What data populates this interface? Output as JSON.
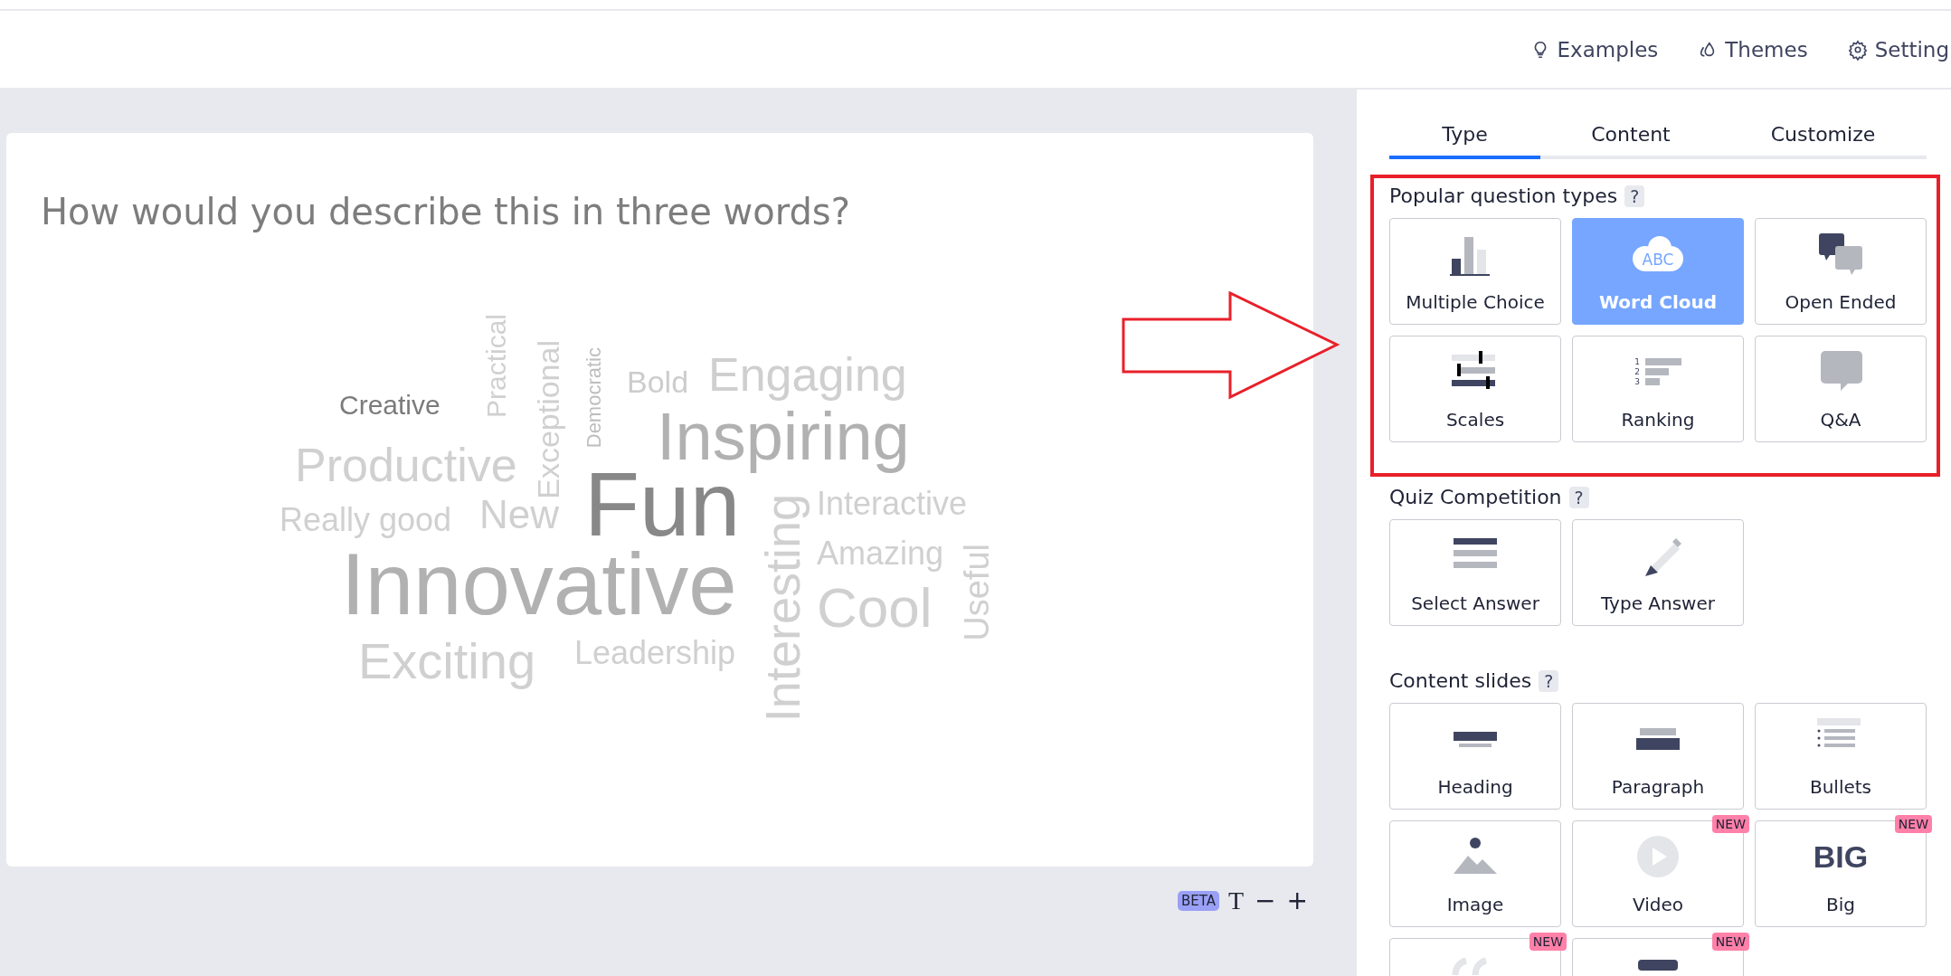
{
  "header": {
    "links": [
      {
        "kind": "bulb",
        "label": "Examples"
      },
      {
        "kind": "drop",
        "label": "Themes"
      },
      {
        "kind": "gear",
        "label": "Setting"
      }
    ]
  },
  "slide": {
    "question": "How would you describe this in three words?",
    "words": [
      {
        "text": "Creative",
        "kind": "horizontal",
        "color": "#7b7b7b"
      },
      {
        "text": "Practical",
        "kind": "vertical",
        "color": "#d0d0d0"
      },
      {
        "text": "Exceptional",
        "kind": "vertical",
        "color": "#d0d0d0"
      },
      {
        "text": "Democratic",
        "kind": "vertical",
        "color": "#bdbdbd"
      },
      {
        "text": "Bold",
        "kind": "horizontal",
        "color": "#cccccc"
      },
      {
        "text": "Engaging",
        "kind": "horizontal",
        "color": "#cfcfcf"
      },
      {
        "text": "Productive",
        "kind": "horizontal",
        "color": "#d0d0d0"
      },
      {
        "text": "Inspiring",
        "kind": "horizontal",
        "color": "#b1b1b1"
      },
      {
        "text": "Really good",
        "kind": "horizontal",
        "color": "#d0d0d0"
      },
      {
        "text": "New",
        "kind": "horizontal",
        "color": "#d0d0d0"
      },
      {
        "text": "Fun",
        "kind": "horizontal",
        "color": "#888888"
      },
      {
        "text": "Interesting",
        "kind": "vertical",
        "color": "#d0d0d0"
      },
      {
        "text": "Interactive",
        "kind": "horizontal",
        "color": "#d0d0d0"
      },
      {
        "text": "Amazing",
        "kind": "horizontal",
        "color": "#d0d0d0"
      },
      {
        "text": "Useful",
        "kind": "vertical",
        "color": "#d0d0d0"
      },
      {
        "text": "Innovative",
        "kind": "horizontal",
        "color": "#b1b1b1"
      },
      {
        "text": "Cool",
        "kind": "horizontal",
        "color": "#d0d0d0"
      },
      {
        "text": "Exciting",
        "kind": "horizontal",
        "color": "#d0d0d0"
      },
      {
        "text": "Leadership",
        "kind": "horizontal",
        "color": "#d0d0d0"
      }
    ]
  },
  "toolbar": {
    "badge": "BETA",
    "buttons": [
      "T",
      "−",
      "+"
    ]
  },
  "tabs": [
    {
      "label": "Type",
      "selected": true
    },
    {
      "label": "Content",
      "selected": false
    },
    {
      "label": "Customize",
      "selected": false
    }
  ],
  "sections": [
    {
      "title": "Popular question types",
      "help": "?",
      "cards": [
        {
          "kind": "bars",
          "label": "Multiple Choice",
          "selected": false
        },
        {
          "kind": "cloud",
          "label": "Word Cloud",
          "icon_text": "ABC",
          "selected": true
        },
        {
          "kind": "bubbles",
          "label": "Open Ended",
          "selected": false
        },
        {
          "kind": "sliders",
          "label": "Scales",
          "selected": false
        },
        {
          "kind": "ranking",
          "label": "Ranking",
          "icon_text": "1 2 3",
          "selected": false
        },
        {
          "kind": "bubble",
          "label": "Q&A",
          "selected": false
        }
      ]
    },
    {
      "title": "Quiz Competition",
      "help": "?",
      "cards": [
        {
          "kind": "lines",
          "label": "Select Answer",
          "selected": false
        },
        {
          "kind": "pencil",
          "label": "Type Answer",
          "selected": false
        }
      ]
    },
    {
      "title": "Content slides",
      "help": "?",
      "cards": [
        {
          "kind": "heading",
          "label": "Heading",
          "selected": false
        },
        {
          "kind": "paragraph",
          "label": "Paragraph",
          "selected": false
        },
        {
          "kind": "bullets",
          "label": "Bullets",
          "selected": false
        },
        {
          "kind": "image",
          "label": "Image",
          "selected": false
        },
        {
          "kind": "video",
          "label": "Video",
          "badge": "NEW",
          "selected": false
        },
        {
          "kind": "big",
          "label": "Big",
          "icon_text": "BIG",
          "badge": "NEW",
          "selected": false
        },
        {
          "kind": "quote",
          "badge": "NEW",
          "selected": false
        },
        {
          "kind": "number",
          "badge": "NEW",
          "selected": false
        }
      ]
    }
  ]
}
